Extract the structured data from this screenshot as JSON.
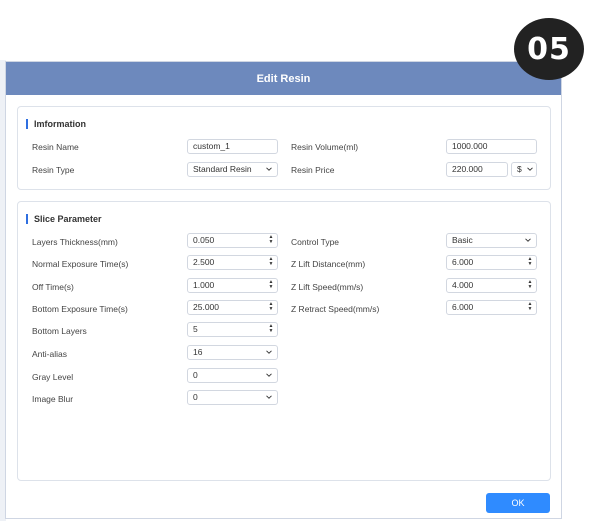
{
  "badge": "05",
  "dialog": {
    "title": "Edit Resin",
    "ok_label": "OK"
  },
  "information": {
    "title": "Imformation",
    "resin_name_label": "Resin Name",
    "resin_name_value": "custom_1",
    "resin_volume_label": "Resin Volume(ml)",
    "resin_volume_value": "1000.000",
    "resin_type_label": "Resin Type",
    "resin_type_value": "Standard Resin",
    "resin_price_label": "Resin Price",
    "resin_price_value": "220.000",
    "currency_value": "$"
  },
  "slice": {
    "title": "Slice Parameter",
    "layers_thickness_label": "Layers Thickness(mm)",
    "layers_thickness_value": "0.050",
    "normal_exposure_label": "Normal Exposure Time(s)",
    "normal_exposure_value": "2.500",
    "off_time_label": "Off Time(s)",
    "off_time_value": "1.000",
    "bottom_exposure_label": "Bottom Exposure Time(s)",
    "bottom_exposure_value": "25.000",
    "bottom_layers_label": "Bottom Layers",
    "bottom_layers_value": "5",
    "anti_alias_label": "Anti-alias",
    "anti_alias_value": "16",
    "gray_level_label": "Gray Level",
    "gray_level_value": "0",
    "image_blur_label": "Image Blur",
    "image_blur_value": "0",
    "control_type_label": "Control Type",
    "control_type_value": "Basic",
    "z_lift_distance_label": "Z Lift Distance(mm)",
    "z_lift_distance_value": "6.000",
    "z_lift_speed_label": "Z Lift Speed(mm/s)",
    "z_lift_speed_value": "4.000",
    "z_retract_speed_label": "Z Retract Speed(mm/s)",
    "z_retract_speed_value": "6.000"
  },
  "colors": {
    "titlebar": "#6d89bd",
    "accent": "#2f6fe0",
    "ok_button": "#2f8bff"
  }
}
